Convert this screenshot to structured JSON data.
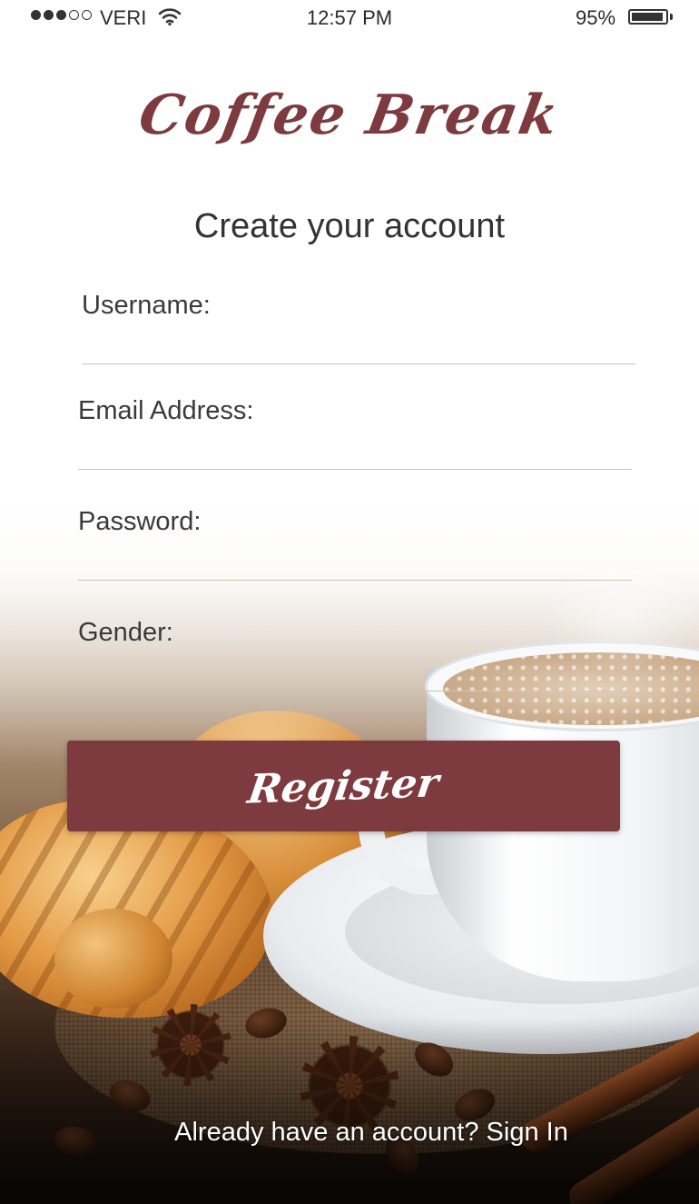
{
  "status_bar": {
    "carrier": "VERI",
    "time": "12:57 PM",
    "battery_percent_label": "95%",
    "battery_level": 0.95,
    "signal_strength_dots": 3,
    "signal_total_dots": 5
  },
  "brand": {
    "name": "Coffee Break",
    "color": "#7d3a3f"
  },
  "heading": "Create your account",
  "form": {
    "fields": [
      {
        "label": "Username:",
        "value": "",
        "placeholder": "",
        "type": "text"
      },
      {
        "label": "Email Address:",
        "value": "",
        "placeholder": "",
        "type": "email"
      },
      {
        "label": "Password:",
        "value": "",
        "placeholder": "",
        "type": "password"
      },
      {
        "label": "Gender:",
        "value": "",
        "placeholder": "",
        "type": "text"
      }
    ]
  },
  "register_button": {
    "label": "Register",
    "color": "#7d3a3f"
  },
  "signin": {
    "prompt": "Already have an account?",
    "link": "Sign In"
  },
  "icons": {
    "wifi": "wifi-icon",
    "battery": "battery-icon",
    "signal": "signal-strength-icon"
  }
}
